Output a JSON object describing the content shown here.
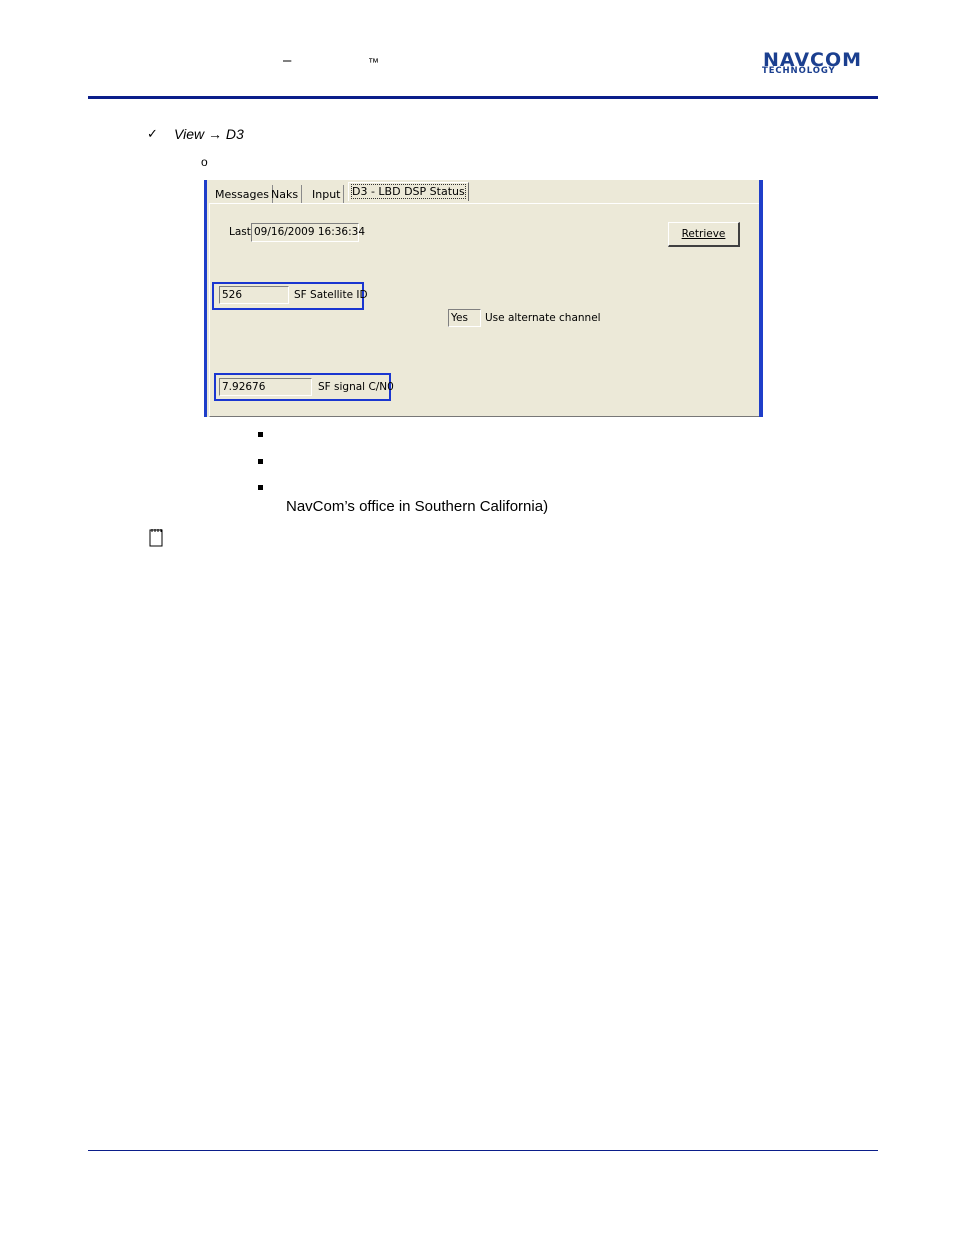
{
  "header": {
    "dash": "–",
    "trademark": "™",
    "logo_line1": "NAVCOM",
    "logo_line2": "TECHNOLOGY"
  },
  "step": {
    "check": "✓",
    "text": "View → D3",
    "sub_bullet": "o"
  },
  "screenshot": {
    "tabs": [
      "Messages",
      "Naks",
      "Input",
      "D3 - LBD DSP Status"
    ],
    "active_tab": "D3 - LBD DSP Status",
    "last_label": "Last:",
    "last_value": "09/16/2009 16:36:34",
    "retrieve_label": "Retrieve",
    "satellite_id_value": "526",
    "satellite_id_label": "SF Satellite ID",
    "alternate_value": "Yes",
    "alternate_label": "Use alternate channel",
    "cn0_value": "7.92676",
    "cn0_label": "SF signal C/N0"
  },
  "bullets": {
    "continuation": "NavCom’s office in Southern California)"
  }
}
